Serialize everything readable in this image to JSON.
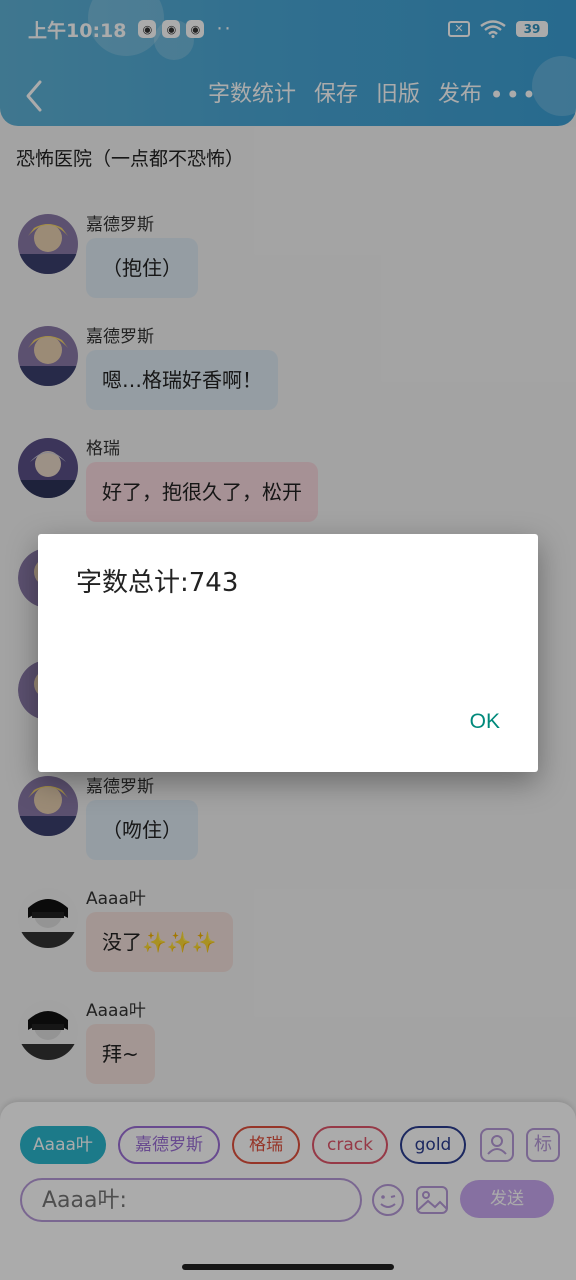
{
  "status_bar": {
    "time": "上午10:18",
    "notif_icons": [
      "app-icon",
      "app-icon",
      "app-icon"
    ],
    "dots": "··",
    "battery": "39"
  },
  "navbar": {
    "items": [
      "字数统计",
      "保存",
      "旧版",
      "发布"
    ],
    "more": "•••"
  },
  "story_title": "恐怖医院（一点都不恐怖）",
  "messages": [
    {
      "name": "嘉德罗斯",
      "text": "（抱住）",
      "color": "blue"
    },
    {
      "name": "嘉德罗斯",
      "text": "嗯…格瑞好香啊！",
      "color": "blue"
    },
    {
      "name": "格瑞",
      "text": "好了，抱很久了，松开",
      "color": "pink"
    },
    {
      "name": "嘉德罗斯",
      "text": "（吻住）",
      "color": "blue"
    },
    {
      "name": "Aaaa叶",
      "text": "没了✨✨✨",
      "color": "peach"
    },
    {
      "name": "Aaaa叶",
      "text": "拜~",
      "color": "peach"
    }
  ],
  "characters": [
    {
      "label": "Aaaa叶",
      "color": "#2ab6cc",
      "active": true
    },
    {
      "label": "嘉德罗斯",
      "color": "#9b6fd6",
      "active": false
    },
    {
      "label": "格瑞",
      "color": "#e0503c",
      "active": false
    },
    {
      "label": "crack",
      "color": "#e0566a",
      "active": false
    },
    {
      "label": "gold",
      "color": "#2a3c8f",
      "active": false
    }
  ],
  "tag_icon_label": "标",
  "input": {
    "placeholder": "Aaaa叶:"
  },
  "send_label": "发送",
  "dialog": {
    "title": "字数总计:743",
    "ok": "OK"
  }
}
